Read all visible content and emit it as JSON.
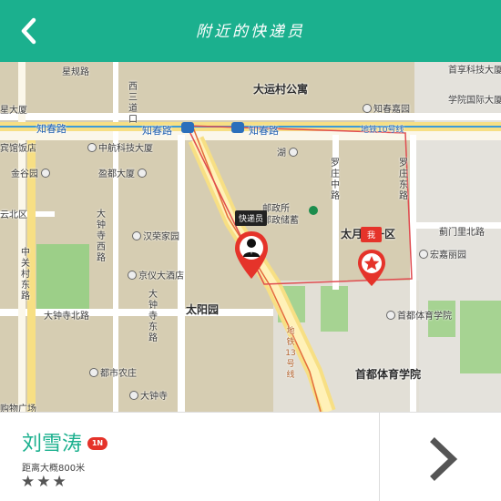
{
  "header": {
    "title": "附近的快递员",
    "back_icon": "chevron-left-icon"
  },
  "map": {
    "roads": {
      "xingui": "星规路",
      "zhichun_left": "知春路",
      "zhichun_center": "知春路",
      "zhichun_right": "知春路",
      "xisan_dao": "西三道口",
      "dazhongsi_west": "大钟寺西路",
      "dazhongsi_north": "大钟寺北路",
      "dazhongsi_east": "大钟寺东路",
      "zhongguancun_east": "中关村东路",
      "luozhuang_middle": "罗庄中路",
      "luozhuang_east": "罗庄东路",
      "jimen_north": "蓟门里北路",
      "metro_line": "地铁10号线",
      "metro_line_diagonal": "地铁13号线"
    },
    "places": {
      "dayuncun": "大运村公寓",
      "zhichunjiayuan": "知春嘉园",
      "shoujian": "首享科技大厦",
      "xueyuan": "学院国际大厦",
      "ship_building": "星大厦",
      "hotel": "宾馆饭店",
      "jingu": "金谷园",
      "yunbei": "云北区",
      "zhonghang": "中航科技大厦",
      "yingdu": "盈都大厦",
      "hanrong": "汉荣家园",
      "jingyi": "京仪大酒店",
      "taiyangyuan": "太阳园",
      "duoshi": "都市农庄",
      "dazhongsi": "大钟寺",
      "gouwu": "购物广场",
      "youzheng": "邮政所",
      "youchu": "邮政储蓄",
      "hu": "湖",
      "taiyueyuan": "太月园一区",
      "hongjia": "宏嘉丽园",
      "tiyu_road": "首都体育学院",
      "tiyu": "首都体育学院"
    },
    "courier_marker_label": "快递员",
    "me_marker_label": "我"
  },
  "courier": {
    "name": "刘雪涛",
    "badge": "1N",
    "distance": "距离大概800米",
    "rating_stars": 3,
    "stars_text": "★★★"
  },
  "detail_icon": "chevron-right-icon",
  "colors": {
    "brand": "#1bb08e",
    "marker_red": "#e5332a",
    "metro": "#3c9bd8"
  }
}
